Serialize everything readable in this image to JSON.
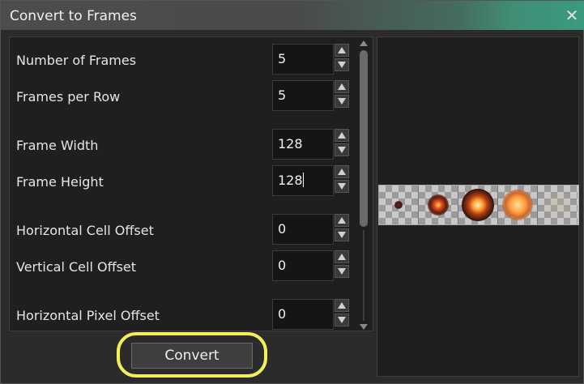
{
  "window": {
    "title": "Convert to Frames"
  },
  "fields": [
    {
      "label": "Number of Frames",
      "value": "5"
    },
    {
      "label": "Frames per Row",
      "value": "5"
    },
    {
      "label": "Frame Width",
      "value": "128"
    },
    {
      "label": "Frame Height",
      "value": "128"
    },
    {
      "label": "Horizontal Cell Offset",
      "value": "0"
    },
    {
      "label": "Vertical Cell Offset",
      "value": "0"
    },
    {
      "label": "Horizontal Pixel Offset",
      "value": "0"
    }
  ],
  "preview": {
    "frame_count": 5
  },
  "buttons": {
    "convert": "Convert"
  },
  "icons": {
    "close": "close-icon",
    "spin_up": "triangle-up-icon",
    "spin_down": "triangle-down-icon"
  },
  "colors": {
    "highlight": "#f2ef5a",
    "titlebar_accent": "#3a9a80"
  }
}
